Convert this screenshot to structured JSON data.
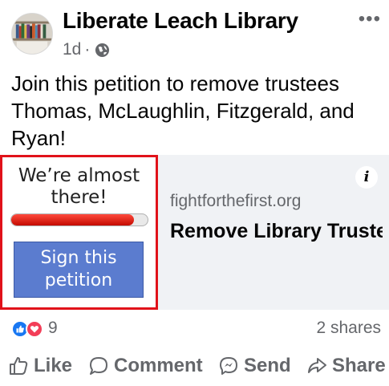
{
  "post": {
    "page_name": "Liberate Leach Library",
    "time": "1d",
    "separator": "·",
    "privacy_icon": "globe-icon",
    "more_icon": "more-options-icon",
    "more_label": "•••",
    "text": "Join this petition to remove trustees Thomas, McLaughlin, Fitzgerald, and Ryan!"
  },
  "link_preview": {
    "thumbnail": {
      "title": "We’re almost there!",
      "progress": 0.9,
      "progress_color": "#d21a0f",
      "button_label": "Sign this petition",
      "button_color": "#5b7ccf",
      "border_color": "#e1121a"
    },
    "domain": "fightforthefirst.org",
    "title": "Remove Library Trustees Liz Thom…",
    "info_icon": "info-icon",
    "info_label": "i"
  },
  "engagement": {
    "reaction_icons": [
      "like-icon",
      "love-icon"
    ],
    "reaction_count": "9",
    "shares": "2 shares"
  },
  "actions": [
    {
      "label": "Like",
      "icon": "thumbs-up-icon"
    },
    {
      "label": "Comment",
      "icon": "comment-icon"
    },
    {
      "label": "Send",
      "icon": "messenger-icon"
    },
    {
      "label": "Share",
      "icon": "share-icon"
    }
  ],
  "colors": {
    "text_primary": "#050505",
    "text_secondary": "#65676b",
    "link_card_bg": "#f0f2f5",
    "like_blue": "#1877f2",
    "love_red": "#f33e58"
  }
}
